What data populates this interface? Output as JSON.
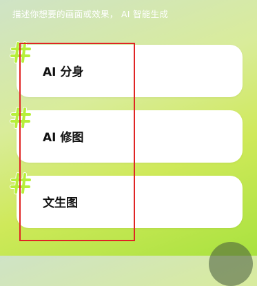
{
  "header": {
    "prompt_text": "描述你想要的画面或效果， AI 智能生成"
  },
  "cards": [
    {
      "label": "AI 分身",
      "icon": "hash-icon"
    },
    {
      "label": "AI 修图",
      "icon": "hash-icon"
    },
    {
      "label": "文生图",
      "icon": "hash-icon"
    }
  ],
  "colors": {
    "hash_fill": "#b6ef3a",
    "hash_outline": "#ffffff",
    "highlight_border": "#e02424",
    "card_bg": "#ffffff"
  }
}
